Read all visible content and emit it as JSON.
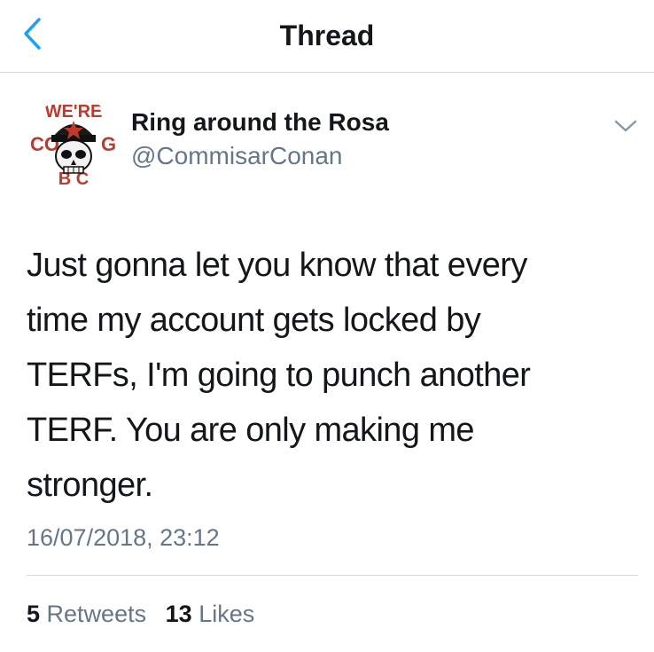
{
  "header": {
    "title": "Thread",
    "back_icon": "chevron-left-icon",
    "accent_color": "#1da1f2"
  },
  "tweet": {
    "display_name": "Ring around the Rosa",
    "handle": "@CommisarConan",
    "avatar_icon": "skull-emblem-avatar",
    "avatar_lettering": [
      "WE'RE",
      "COMING",
      "BACK"
    ],
    "text_lines": [
      "Just gonna let you know that every",
      "time my account gets locked by",
      "TERFs, I'm going to punch another",
      "TERF. You are only making me",
      "stronger."
    ],
    "timestamp": "16/07/2018, 23:12",
    "retweet_count": "5",
    "retweet_label": "Retweets",
    "like_count": "13",
    "like_label": "Likes",
    "menu_icon": "chevron-down-icon"
  },
  "colors": {
    "text_primary": "#14171a",
    "text_secondary": "#657786",
    "divider": "#d6d9dc",
    "avatar_red": "#c0392b"
  }
}
